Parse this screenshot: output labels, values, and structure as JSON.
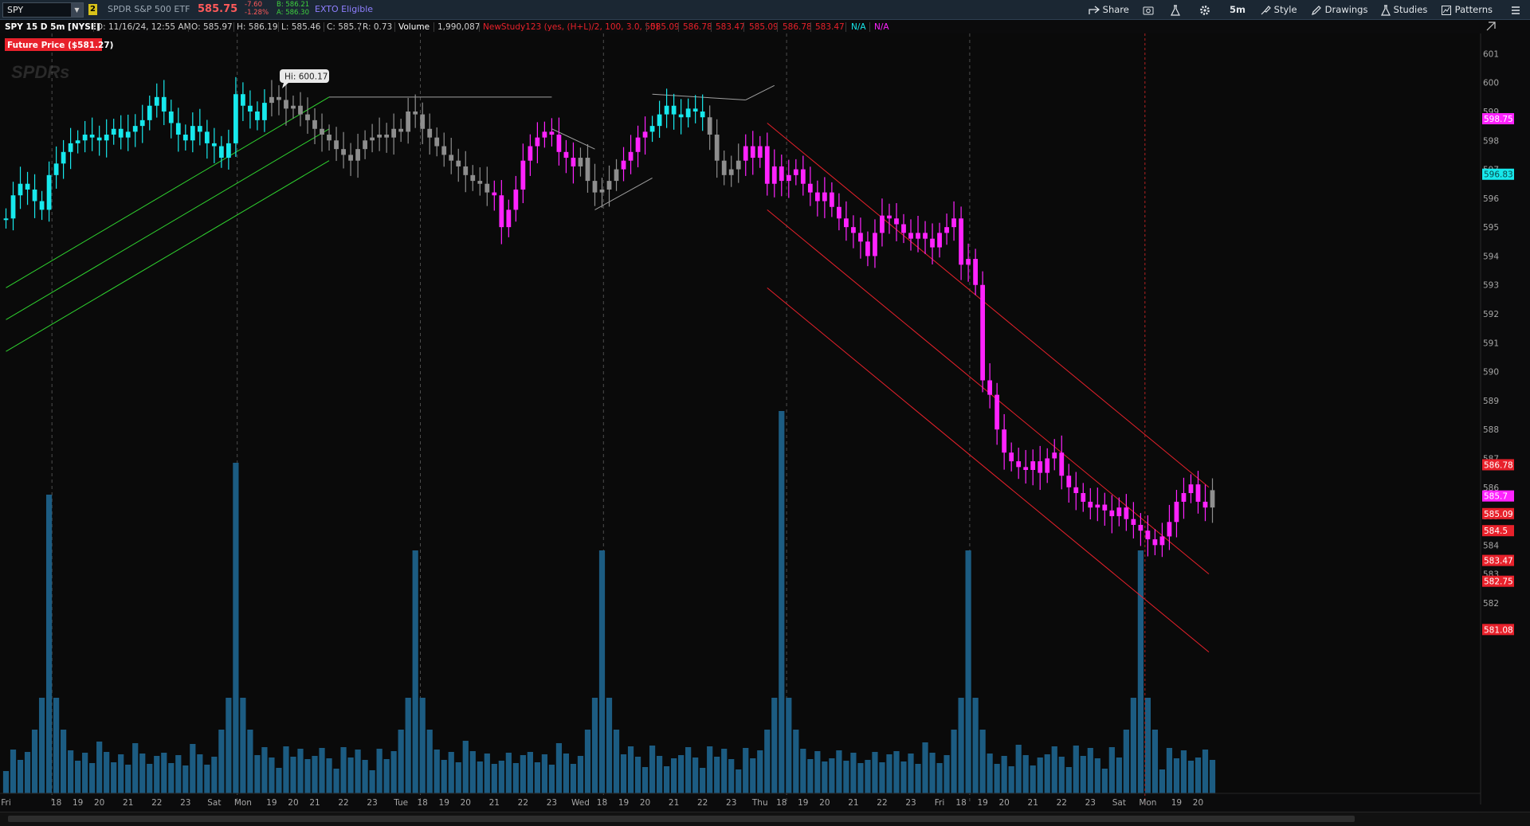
{
  "toolbar": {
    "symbol": "SPY",
    "link_number": "2",
    "description": "SPDR S&P 500 ETF",
    "last_price": "585.75",
    "net_change": "-7.60",
    "pct_change": "-1.28%",
    "bid": "B: 586.21",
    "ask": "A: 586.30",
    "exto": "EXTO Eligible",
    "share_label": "Share",
    "interval_label": "5m",
    "style_label": "Style",
    "drawings_label": "Drawings",
    "studies_label": "Studies",
    "patterns_label": "Patterns"
  },
  "study_bar": {
    "chart_title": "SPY 15 D 5m [NYSE]",
    "date": "D: 11/16/24, 12:55 AM",
    "open": "O: 585.97",
    "high": "H: 586.19",
    "low": "L: 585.46",
    "close": "C: 585.7",
    "range": "R: 0.73",
    "volume_label": "Volume",
    "volume_value": "1,990,087",
    "study_name": "NewStudy123 (yes, (H+L)/2, 100, 3.0, 50)",
    "study_values": [
      "585.09",
      "586.78",
      "583.47",
      "585.09",
      "586.78",
      "583.47"
    ],
    "na_1": "N/A",
    "na_2": "N/A"
  },
  "overlay": {
    "future_price": "Future Price ($581.27)",
    "watermark": "SPDRs",
    "high_bubble": "Hi: 600.17"
  },
  "colors": {
    "up_trend": "#17e8ec",
    "down_trend": "#ff23ff",
    "neutral": "#8e8e8e",
    "channel_red": "#e8212b",
    "channel_green": "#2fd32f",
    "volume": "#1c5c82",
    "price_badge_red": "#e8212b"
  },
  "chart_data": {
    "type": "candlestick",
    "title": "SPY 15 D 5m [NYSE]",
    "y_axis": {
      "min": 580.4,
      "max": 601.7,
      "ticks": [
        582,
        583,
        584,
        585,
        586,
        587,
        588,
        589,
        590,
        591,
        592,
        593,
        594,
        595,
        596,
        597,
        598,
        599,
        600,
        601
      ]
    },
    "x_axis": {
      "labels": [
        "Fri",
        "18",
        "19",
        "20",
        "21",
        "22",
        "23",
        "Sat",
        "Mon",
        "19",
        "20",
        "21",
        "22",
        "23",
        "Tue",
        "18",
        "19",
        "20",
        "21",
        "22",
        "23",
        "Wed",
        "18",
        "19",
        "20",
        "21",
        "22",
        "23",
        "Thu",
        "18",
        "19",
        "20",
        "21",
        "22",
        "23",
        "Fri",
        "18",
        "19",
        "20",
        "21",
        "22",
        "23",
        "Sat",
        "Mon",
        "19",
        "20"
      ],
      "index": [
        0,
        7,
        10,
        13,
        17,
        21,
        25,
        29,
        33,
        37,
        40,
        43,
        47,
        51,
        55,
        58,
        61,
        64,
        68,
        72,
        76,
        80,
        83,
        86,
        89,
        93,
        97,
        101,
        105,
        108,
        111,
        114,
        118,
        122,
        126,
        130,
        133,
        136,
        139,
        143,
        147,
        151,
        155,
        159,
        163,
        166
      ],
      "session_dividers": [
        6.4,
        32.2,
        57.7,
        83.2,
        108.7,
        134.2
      ],
      "now_index": 158,
      "extent": [
        -0.5,
        167.5
      ]
    },
    "price_series": {
      "close": [
        595.3,
        596.1,
        596.5,
        596.3,
        595.9,
        595.6,
        596.8,
        597.2,
        597.6,
        597.9,
        598.0,
        598.2,
        598.1,
        598.0,
        598.2,
        598.4,
        598.1,
        598.3,
        598.5,
        598.7,
        599.2,
        599.5,
        599.0,
        598.6,
        598.2,
        598.0,
        598.5,
        598.3,
        597.9,
        597.8,
        597.4,
        597.9,
        599.6,
        599.2,
        599.0,
        598.7,
        599.3,
        599.5,
        599.4,
        599.1,
        599.2,
        598.9,
        598.7,
        598.4,
        598.2,
        598.0,
        597.7,
        597.5,
        597.3,
        597.7,
        598.0,
        598.1,
        598.2,
        598.1,
        598.4,
        598.3,
        599.0,
        598.9,
        598.4,
        598.1,
        597.8,
        597.5,
        597.3,
        597.1,
        596.8,
        596.6,
        596.5,
        596.2,
        596.1,
        595.0,
        595.6,
        596.3,
        597.3,
        597.8,
        598.1,
        598.3,
        598.2,
        597.6,
        597.4,
        597.1,
        597.4,
        596.6,
        596.2,
        596.3,
        596.6,
        597.0,
        597.3,
        597.6,
        598.1,
        598.3,
        598.5,
        598.9,
        599.2,
        598.9,
        598.8,
        599.1,
        599.0,
        598.8,
        598.2,
        597.3,
        596.8,
        597.0,
        597.3,
        597.8,
        597.4,
        597.8,
        596.5,
        597.1,
        596.6,
        596.8,
        597.0,
        596.5,
        596.2,
        595.9,
        596.2,
        595.7,
        595.3,
        595.0,
        594.8,
        594.5,
        594.0,
        594.8,
        595.4,
        595.3,
        595.1,
        594.8,
        594.6,
        594.8,
        594.6,
        594.3,
        594.8,
        595.0,
        595.3,
        593.7,
        593.9,
        593.0,
        589.7,
        589.2,
        588.0,
        587.2,
        586.9,
        586.7,
        586.6,
        586.9,
        586.5,
        587.0,
        587.2,
        586.4,
        586.0,
        585.8,
        585.5,
        585.3,
        585.4,
        585.2,
        585.0,
        585.3,
        584.9,
        584.7,
        584.5,
        584.2,
        584.0,
        584.3,
        584.8,
        585.5,
        585.8,
        586.1,
        585.5,
        585.3,
        585.9
      ],
      "color_state": "cyan 0-36, gray 37-67, magenta 68-79, gray 80-85, magenta 86-89, cyan 90-97, gray 98-102, magenta 103-167"
    },
    "current_price": 585.7,
    "high_marker": {
      "index": 32,
      "value": 600.17
    },
    "price_labels": [
      598.75,
      596.83,
      586.78,
      585.7,
      585.09,
      584.5,
      583.47,
      582.75,
      581.08
    ],
    "volume": {
      "note": "Volume histogram scaled to bottom pane; spikes at session opens",
      "spike_indices": [
        6,
        32,
        57,
        83,
        108,
        134,
        158
      ]
    },
    "channels": {
      "green_channel": {
        "from": [
          0,
          592.9
        ],
        "to": [
          45,
          599.5
        ],
        "offsets": [
          0,
          -1.1,
          -2.2
        ]
      },
      "gray_channel_segments": [
        [
          45,
          599.5,
          76,
          599.5
        ],
        [
          76,
          598.4,
          82,
          597.7
        ],
        [
          82,
          595.6,
          90,
          596.7
        ],
        [
          90,
          599.6,
          103,
          599.4
        ],
        [
          103,
          599.4,
          107,
          599.9
        ]
      ],
      "red_downtrend_channel": {
        "from": [
          106,
          598.6
        ],
        "to": [
          167.5,
          586.0
        ],
        "offsets": [
          0,
          -3.0,
          -5.7
        ]
      }
    },
    "legend": "none",
    "grid": false
  }
}
